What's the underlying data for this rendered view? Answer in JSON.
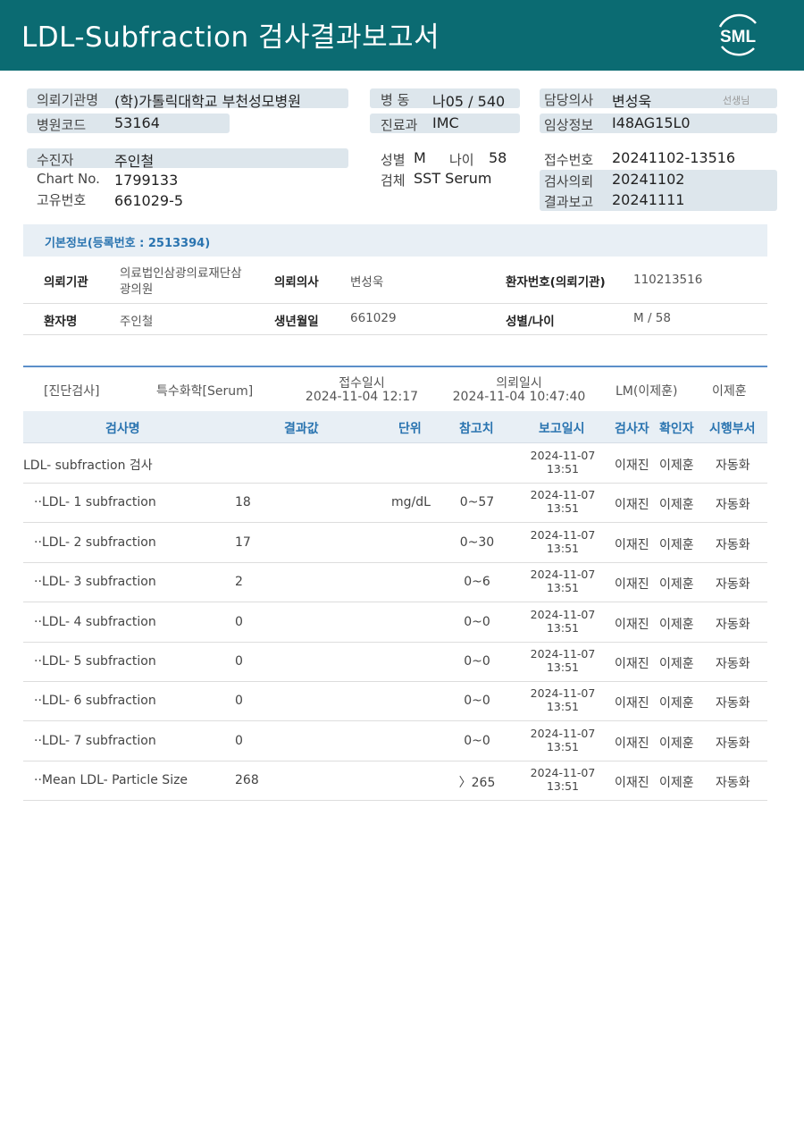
{
  "header": {
    "title": "LDL-Subfraction 검사결과보고서",
    "logo_text": "SML"
  },
  "info": {
    "requester_label": "의뢰기관명",
    "requester": "(학)가톨릭대학교 부천성모병원",
    "ward_label": "병   동",
    "ward": "나05 / 540",
    "doctor_label": "담당의사",
    "doctor": "변성욱",
    "doctor_suffix": "선생님",
    "hospital_code_label": "병원코드",
    "hospital_code": "53164",
    "dept_label": "진료과",
    "dept": "IMC",
    "clinical_label": "임상정보",
    "clinical": "I48AG15L0",
    "patient_label": "수진자",
    "patient": "주인철",
    "sex_label": "성별",
    "sex": "M",
    "age_label": "나이",
    "age": "58",
    "receipt_no_label": "접수번호",
    "receipt_no": "20241102-13516",
    "chart_label": "Chart No.",
    "chart": "1799133",
    "specimen_label": "검체",
    "specimen": "SST Serum",
    "request_date_label": "검사의뢰",
    "request_date": "20241102",
    "unique_label": "고유번호",
    "unique": "661029-5",
    "report_date_label": "결과보고",
    "report_date": "20241111"
  },
  "basic": {
    "title": "기본정보(등록번호 : 2513394)",
    "inst_label": "의뢰기관",
    "inst_line1": "의료법인삼광의료재단삼",
    "inst_line2": "광의원",
    "doctor_label": "의뢰의사",
    "doctor": "변성욱",
    "patient_no_label": "환자번호(의뢰기관)",
    "patient_no": "110213516",
    "name_label": "환자명",
    "name": "주인철",
    "birth_label": "생년월일",
    "birth": "661029",
    "sexage_label": "성별/나이",
    "sexage": "M / 58"
  },
  "test_info": {
    "category": "[진단검사]",
    "group": "특수화학[Serum]",
    "receipt_label": "접수일시",
    "receipt_time": "2024-11-04 12:17",
    "request_label": "의뢰일시",
    "request_time": "2024-11-04 10:47:40",
    "lm": "LM(이제훈)",
    "checker": "이제훈"
  },
  "table": {
    "headers": {
      "name": "검사명",
      "result": "결과값",
      "unit": "단위",
      "ref": "참고치",
      "date": "보고일시",
      "tester": "검사자",
      "confirmer": "확인자",
      "dept": "시행부서"
    },
    "rows": [
      {
        "name": "LDL- subfraction 검사",
        "result": "",
        "unit": "",
        "ref": "",
        "date1": "2024-11-07",
        "date2": "13:51",
        "tester": "이재진",
        "confirmer": "이제훈",
        "dept": "자동화"
      },
      {
        "name": "··LDL- 1 subfraction",
        "result": "18",
        "unit": "mg/dL",
        "ref": "0~57",
        "date1": "2024-11-07",
        "date2": "13:51",
        "tester": "이재진",
        "confirmer": "이제훈",
        "dept": "자동화"
      },
      {
        "name": "··LDL- 2 subfraction",
        "result": "17",
        "unit": "",
        "ref": "0~30",
        "date1": "2024-11-07",
        "date2": "13:51",
        "tester": "이재진",
        "confirmer": "이제훈",
        "dept": "자동화"
      },
      {
        "name": "··LDL- 3 subfraction",
        "result": "2",
        "unit": "",
        "ref": "0~6",
        "date1": "2024-11-07",
        "date2": "13:51",
        "tester": "이재진",
        "confirmer": "이제훈",
        "dept": "자동화"
      },
      {
        "name": "··LDL- 4 subfraction",
        "result": "0",
        "unit": "",
        "ref": "0~0",
        "date1": "2024-11-07",
        "date2": "13:51",
        "tester": "이재진",
        "confirmer": "이제훈",
        "dept": "자동화"
      },
      {
        "name": "··LDL- 5 subfraction",
        "result": "0",
        "unit": "",
        "ref": "0~0",
        "date1": "2024-11-07",
        "date2": "13:51",
        "tester": "이재진",
        "confirmer": "이제훈",
        "dept": "자동화"
      },
      {
        "name": "··LDL- 6 subfraction",
        "result": "0",
        "unit": "",
        "ref": "0~0",
        "date1": "2024-11-07",
        "date2": "13:51",
        "tester": "이재진",
        "confirmer": "이제훈",
        "dept": "자동화"
      },
      {
        "name": "··LDL- 7 subfraction",
        "result": "0",
        "unit": "",
        "ref": "0~0",
        "date1": "2024-11-07",
        "date2": "13:51",
        "tester": "이재진",
        "confirmer": "이제훈",
        "dept": "자동화"
      },
      {
        "name": "··Mean LDL- Particle Size",
        "result": "268",
        "unit": "",
        "ref": "〉265",
        "date1": "2024-11-07",
        "date2": "13:51",
        "tester": "이재진",
        "confirmer": "이제훈",
        "dept": "자동화"
      }
    ]
  },
  "colors": {
    "header_bg": "#0b6b72",
    "label_band": "#dde6ec",
    "accent_blue": "#2a74b0"
  }
}
